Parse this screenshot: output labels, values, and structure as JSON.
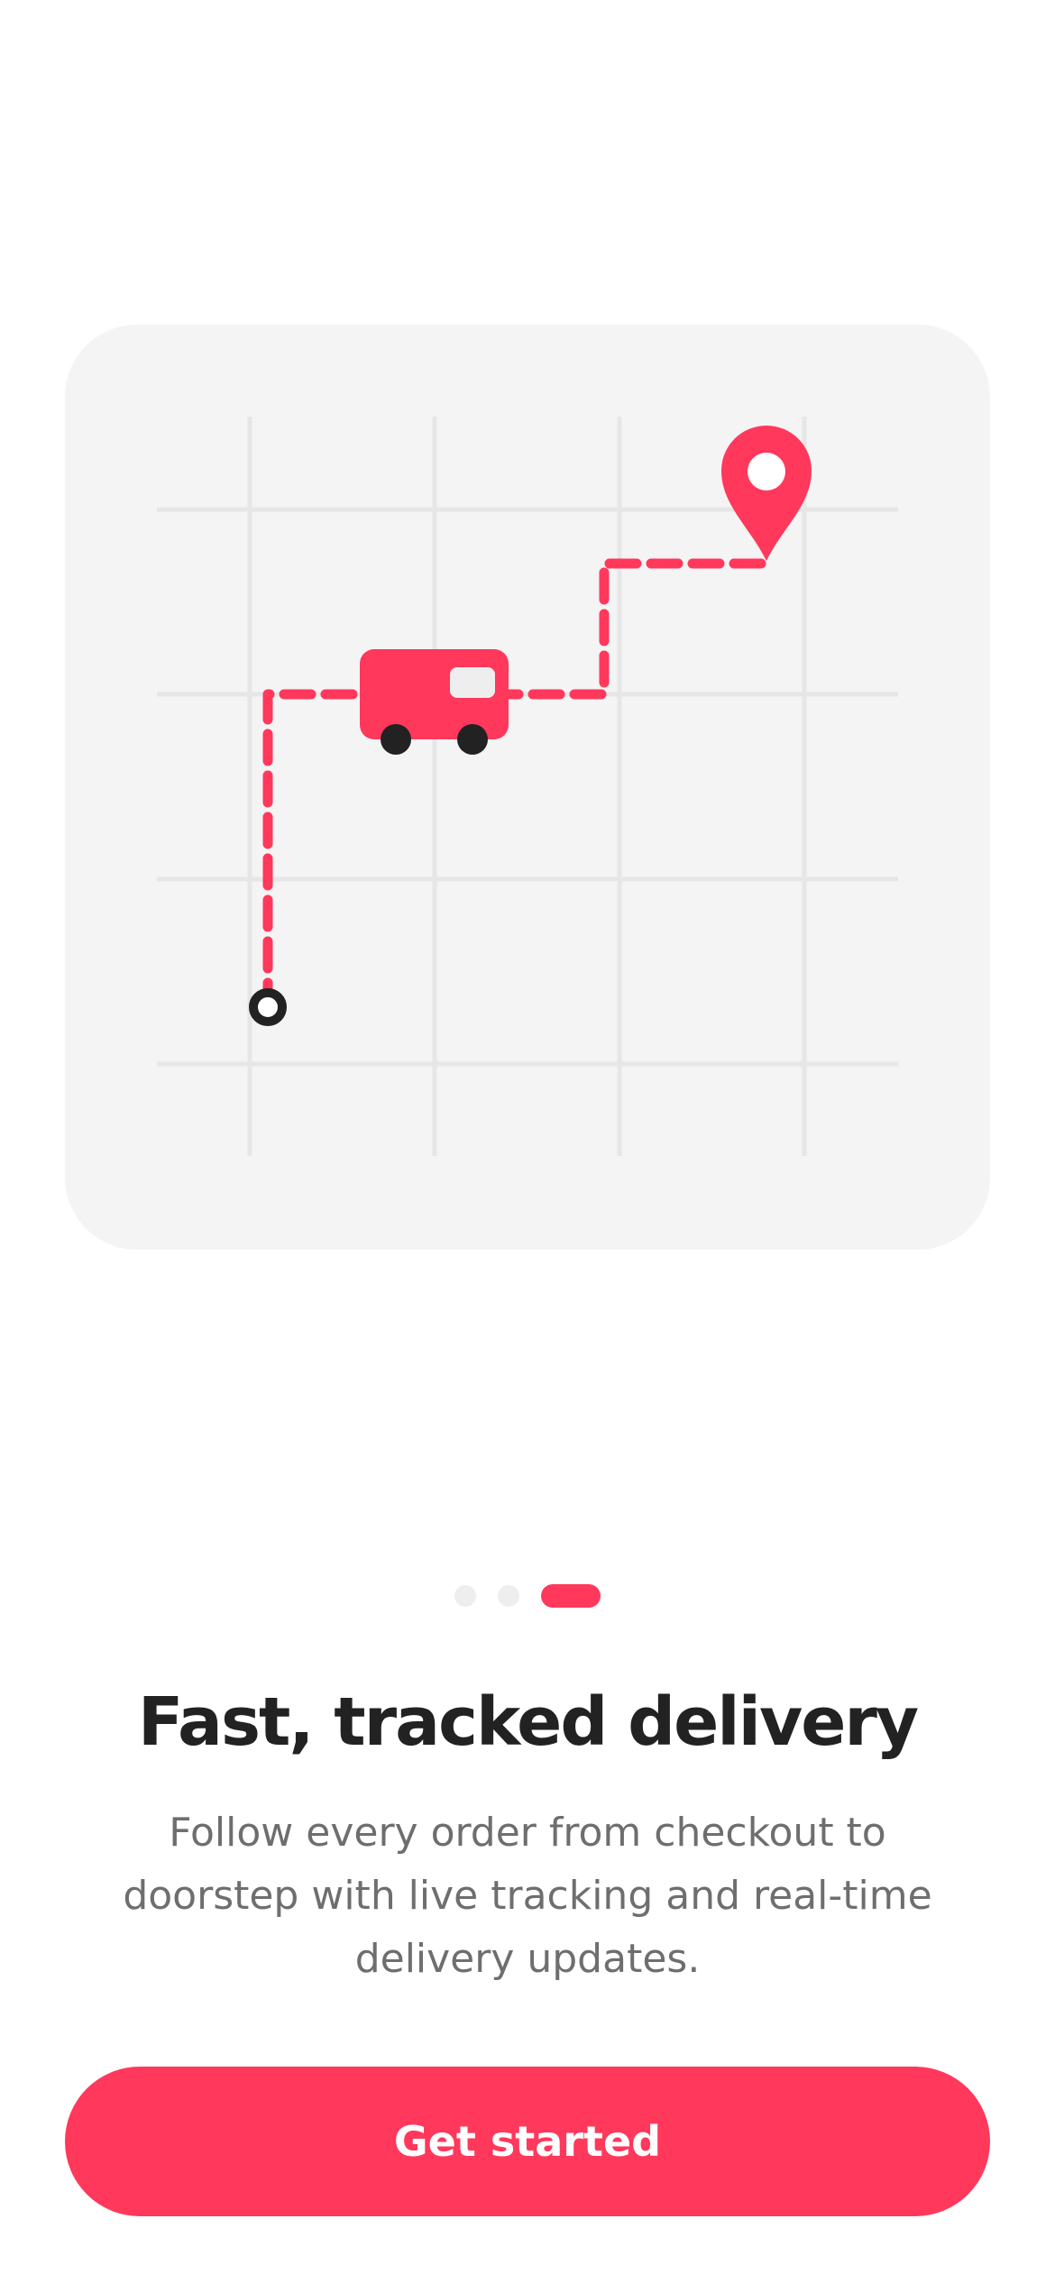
{
  "theme": {
    "accent": "#ff385c",
    "card_background": "#f4f4f4",
    "title_color": "#222222",
    "body_color": "#6e6e6e"
  },
  "illustration": {
    "icons": [
      "delivery-truck-icon",
      "map-pin-icon",
      "route-start-icon",
      "map-grid"
    ]
  },
  "pager": {
    "total": 3,
    "active_index": 2
  },
  "onboarding": {
    "title": "Fast, tracked delivery",
    "description": "Follow every order from checkout to doorstep with live tracking and real-time delivery updates."
  },
  "cta": {
    "label": "Get started"
  }
}
